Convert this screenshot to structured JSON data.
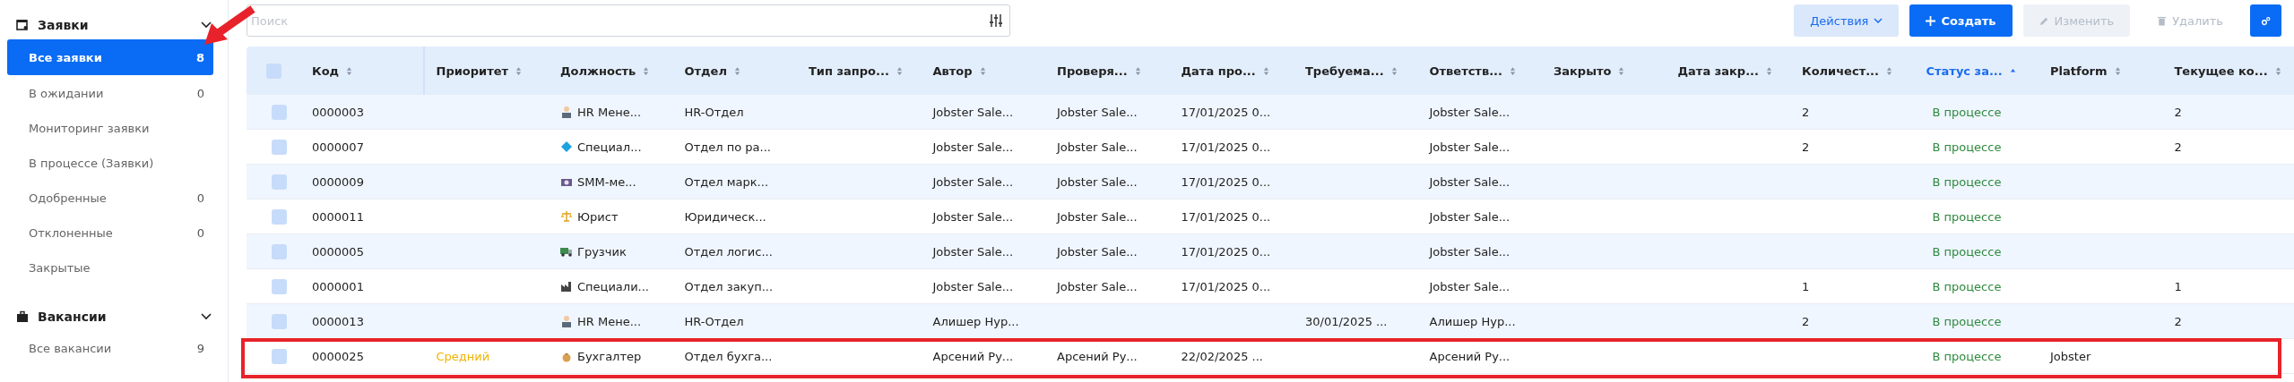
{
  "sidebar": {
    "sections": [
      {
        "title": "Заявки",
        "expanded": true,
        "items": [
          {
            "label": "Все заявки",
            "count": "8",
            "selected": true
          },
          {
            "label": "В ожидании",
            "count": "0",
            "selected": false
          },
          {
            "label": "Мониторинг заявки",
            "selected": false
          },
          {
            "label": "В процессе (Заявки)",
            "selected": false
          },
          {
            "label": "Одобренные",
            "count": "0",
            "selected": false
          },
          {
            "label": "Отклоненные",
            "count": "0",
            "selected": false
          },
          {
            "label": "Закрытые",
            "selected": false
          }
        ]
      },
      {
        "title": "Вакансии",
        "expanded": true,
        "items": [
          {
            "label": "Все вакансии",
            "count": "9",
            "selected": false
          }
        ]
      }
    ]
  },
  "search": {
    "placeholder": "Поиск"
  },
  "actions": [
    {
      "label": "Действия",
      "kind": "menu",
      "disabled": false
    },
    {
      "label": "Создать",
      "kind": "primary",
      "disabled": false
    },
    {
      "label": "Изменить",
      "kind": "edit",
      "disabled": true
    },
    {
      "label": "Удалить",
      "kind": "delete",
      "disabled": true
    },
    {
      "kind": "settings",
      "disabled": false
    }
  ],
  "table": {
    "header_checked": false,
    "columns": [
      {
        "label": "Код",
        "sorted": false
      },
      {
        "label": "Приоритет",
        "sorted": false
      },
      {
        "label": "Должность",
        "sorted": false
      },
      {
        "label": "Отдел",
        "sorted": false
      },
      {
        "label": "Тип запро...",
        "sorted": false
      },
      {
        "label": "Автор",
        "sorted": false
      },
      {
        "label": "Проверя...",
        "sorted": false
      },
      {
        "label": "Дата про...",
        "sorted": false
      },
      {
        "label": "Требуема...",
        "sorted": false
      },
      {
        "label": "Ответств...",
        "sorted": false
      },
      {
        "label": "Закрыто",
        "sorted": false
      },
      {
        "label": "Дата закр...",
        "sorted": false
      },
      {
        "label": "Количест...",
        "sorted": false
      },
      {
        "label": "Статус за...",
        "sorted": true
      },
      {
        "label": "Platform",
        "sorted": false
      },
      {
        "label": "Текущее ко...",
        "sorted": false
      }
    ],
    "rows": [
      {
        "checked": false,
        "highlighted": false,
        "cells": [
          "0000003",
          null,
          "HR Мене...",
          "HR-Отдел",
          null,
          "Jobster Sale...",
          "Jobster Sale...",
          "17/01/2025 0...",
          null,
          "Jobster Sale...",
          null,
          null,
          "2",
          "В процессе",
          null,
          "2"
        ]
      },
      {
        "checked": false,
        "highlighted": false,
        "cells": [
          "0000007",
          null,
          "Специал...",
          "Отдел по ра...",
          null,
          "Jobster Sale...",
          "Jobster Sale...",
          "17/01/2025 0...",
          null,
          "Jobster Sale...",
          null,
          null,
          "2",
          "В процессе",
          null,
          "2"
        ]
      },
      {
        "checked": false,
        "highlighted": false,
        "cells": [
          "0000009",
          null,
          "SMM-ме...",
          "Отдел марк...",
          null,
          "Jobster Sale...",
          "Jobster Sale...",
          "17/01/2025 0...",
          null,
          "Jobster Sale...",
          null,
          null,
          null,
          "В процессе",
          null,
          null
        ]
      },
      {
        "checked": false,
        "highlighted": false,
        "cells": [
          "0000011",
          null,
          "Юрист",
          "Юридическ...",
          null,
          "Jobster Sale...",
          "Jobster Sale...",
          "17/01/2025 0...",
          null,
          "Jobster Sale...",
          null,
          null,
          null,
          "В процессе",
          null,
          null
        ]
      },
      {
        "checked": false,
        "highlighted": false,
        "cells": [
          "0000005",
          null,
          "Грузчик",
          "Отдел логис...",
          null,
          "Jobster Sale...",
          "Jobster Sale...",
          "17/01/2025 0...",
          null,
          "Jobster Sale...",
          null,
          null,
          null,
          "В процессе",
          null,
          null
        ]
      },
      {
        "checked": false,
        "highlighted": false,
        "cells": [
          "0000001",
          null,
          "Специали...",
          "Отдел закуп...",
          null,
          "Jobster Sale...",
          "Jobster Sale...",
          "17/01/2025 0...",
          null,
          "Jobster Sale...",
          null,
          null,
          "1",
          "В процессе",
          null,
          "1"
        ]
      },
      {
        "checked": false,
        "highlighted": false,
        "cells": [
          "0000013",
          null,
          "HR Мене...",
          "HR-Отдел",
          null,
          "Алишер Нур...",
          null,
          null,
          "30/01/2025 ...",
          "Алишер Нур...",
          null,
          null,
          "2",
          "В процессе",
          null,
          "2"
        ]
      },
      {
        "checked": false,
        "highlighted": true,
        "cells": [
          "0000025",
          "Средний",
          "Бухгалтер",
          "Отдел бухга...",
          null,
          "Арсений Ру...",
          "Арсений Ру...",
          "22/02/2025 ...",
          null,
          "Арсений Ру...",
          null,
          null,
          null,
          "В процессе",
          "Jobster",
          null
        ]
      }
    ]
  }
}
